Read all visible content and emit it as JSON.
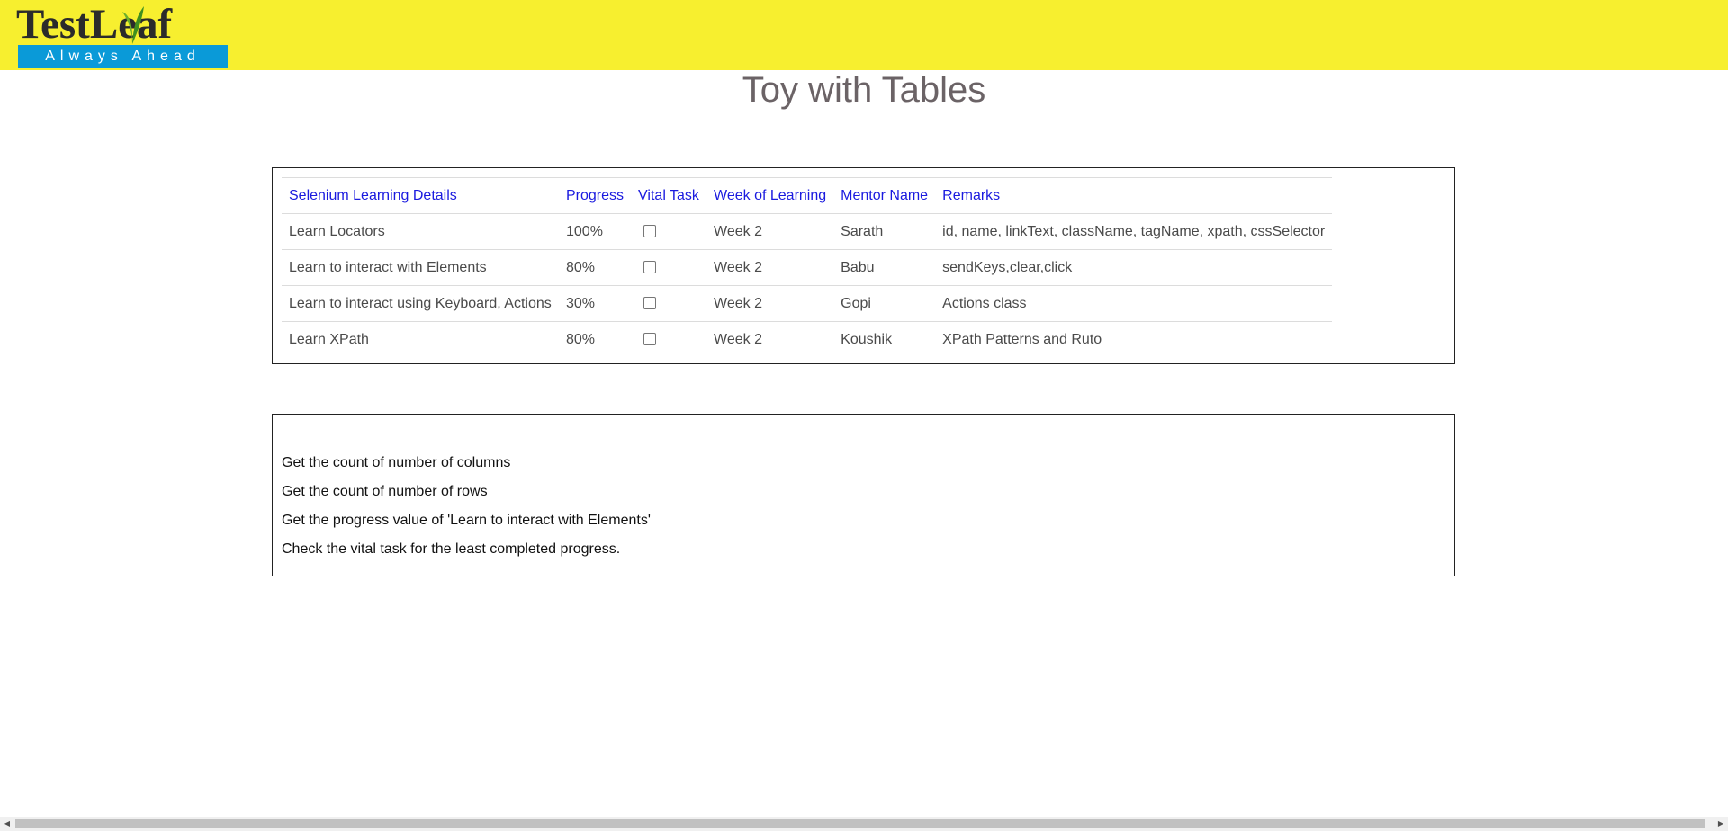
{
  "logo": {
    "brand": "TestLeaf",
    "tagline": "Always Ahead"
  },
  "page": {
    "title": "Toy with Tables"
  },
  "table": {
    "headers": [
      "Selenium Learning Details",
      "Progress",
      "Vital Task",
      "Week of Learning",
      "Mentor Name",
      "Remarks"
    ],
    "rows": [
      {
        "details": "Learn Locators",
        "progress": "100%",
        "vital": false,
        "week": "Week 2",
        "mentor": "Sarath",
        "remarks": "id, name, linkText, className, tagName, xpath, cssSelector"
      },
      {
        "details": "Learn to interact with Elements",
        "progress": "80%",
        "vital": false,
        "week": "Week 2",
        "mentor": "Babu",
        "remarks": "sendKeys,clear,click"
      },
      {
        "details": "Learn to interact using Keyboard, Actions",
        "progress": "30%",
        "vital": false,
        "week": "Week 2",
        "mentor": "Gopi",
        "remarks": "Actions class"
      },
      {
        "details": "Learn XPath",
        "progress": "80%",
        "vital": false,
        "week": "Week 2",
        "mentor": "Koushik",
        "remarks": "XPath Patterns and Ruto"
      }
    ]
  },
  "tasks": [
    "Get the count of number of columns",
    "Get the count of number of rows",
    "Get the progress value of 'Learn to interact with Elements'",
    "Check the vital task for the least completed progress."
  ],
  "colors": {
    "header_bg": "#f7ef2f",
    "header_link": "#1a1adf",
    "logo_tag_bg": "#0a9ad8"
  },
  "icons": {
    "scroll_left": "scroll-left-arrow-icon",
    "scroll_right": "scroll-right-arrow-icon"
  }
}
